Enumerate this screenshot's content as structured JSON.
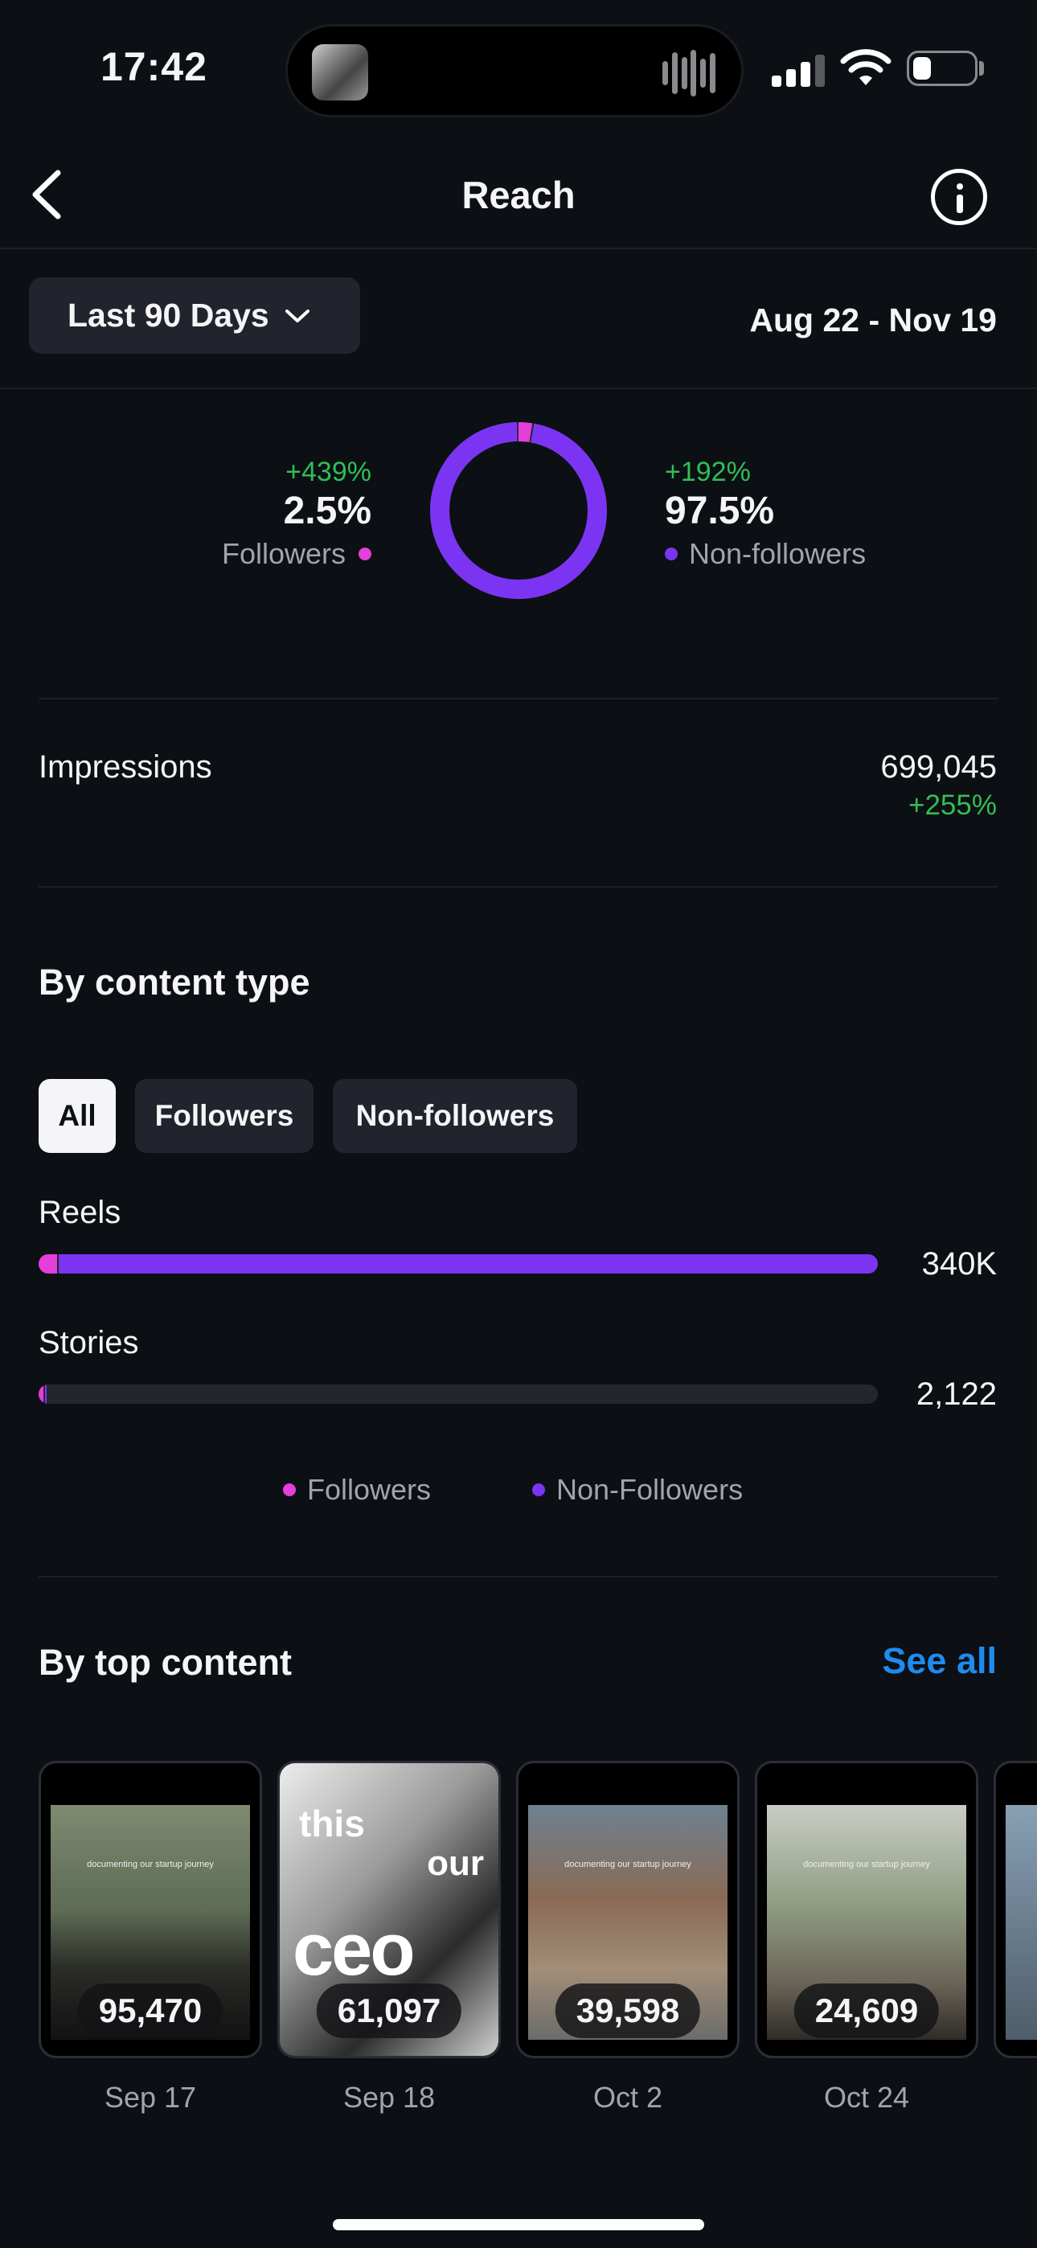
{
  "status_bar": {
    "time": "17:42"
  },
  "header": {
    "title": "Reach"
  },
  "filters": {
    "range_label": "Last 90 Days",
    "date_range": "Aug 22 - Nov 19"
  },
  "audience": {
    "followers": {
      "change": "+439%",
      "percent": "2.5%",
      "label": "Followers",
      "share": 2.5
    },
    "non_followers": {
      "change": "+192%",
      "percent": "97.5%",
      "label": "Non-followers",
      "share": 97.5
    }
  },
  "impressions": {
    "label": "Impressions",
    "value": "699,045",
    "change": "+255%"
  },
  "content_type": {
    "title": "By content type",
    "chips": [
      "All",
      "Followers",
      "Non-followers"
    ],
    "selected_chip": "All",
    "legend": [
      "Followers",
      "Non-Followers"
    ]
  },
  "top_content": {
    "title": "By top content",
    "see_all": "See all",
    "items": [
      {
        "count": "95,470",
        "date": "Sep 17",
        "caption": "documenting our startup journey"
      },
      {
        "count": "61,097",
        "date": "Sep 18",
        "overlay": [
          "this",
          "our",
          "ceo"
        ]
      },
      {
        "count": "39,598",
        "date": "Oct 2",
        "caption": "documenting our startup journey"
      },
      {
        "count": "24,609",
        "date": "Oct 24",
        "caption": "documenting our startup journey"
      }
    ]
  },
  "colors": {
    "followers": "#e43fd8",
    "non_followers": "#7b35f2",
    "positive": "#2fbf55",
    "link": "#1d8cf0"
  },
  "chart_data": [
    {
      "type": "pie",
      "categories": [
        "Followers",
        "Non-followers"
      ],
      "values": [
        2.5,
        97.5
      ]
    },
    {
      "type": "bar",
      "categories": [
        "Reels",
        "Stories"
      ],
      "value_labels": [
        "340K",
        "2,122"
      ],
      "totals": [
        340000,
        2122
      ],
      "max": 340000,
      "series": [
        {
          "name": "Followers",
          "values": [
            2.2,
            0.4
          ]
        },
        {
          "name": "Non-Followers",
          "values": [
            97.8,
            99.6
          ]
        }
      ]
    }
  ]
}
